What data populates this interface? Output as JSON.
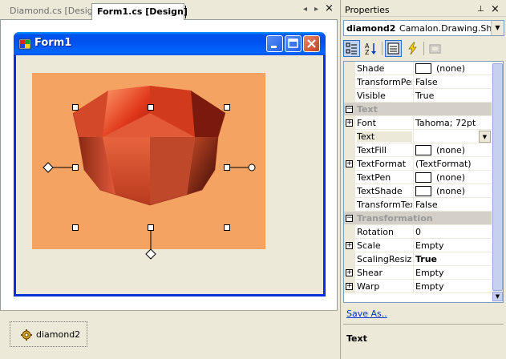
{
  "document_tabs": [
    {
      "label": "Diamond.cs [Design]",
      "active": false
    },
    {
      "label": "Form1.cs [Design]",
      "active": true
    }
  ],
  "tab_controls": {
    "prev": "◂",
    "next": "▸",
    "close": "×"
  },
  "form": {
    "title": "Form1",
    "title_buttons": [
      "minimize",
      "maximize",
      "close"
    ]
  },
  "colors": {
    "panel_background": "#f5a363",
    "diamond_base": "#c0331a",
    "titlebar": "#0054e3",
    "link": "#0033cc"
  },
  "tray": {
    "component_label": "diamond2",
    "icon": "gear-icon"
  },
  "properties": {
    "title": "Properties",
    "pin_glyph": "⊥",
    "close_glyph": "×",
    "object_name": "diamond2",
    "object_type": "Camalon.Drawing.Shape",
    "toolbar_buttons": [
      "categorized-icon",
      "alphabetical-icon",
      "properties-icon",
      "events-icon",
      "property-pages-icon"
    ],
    "rows": [
      {
        "name": "Shade",
        "value": "(none)",
        "kind": "swatch"
      },
      {
        "name": "TransformPen",
        "value": "False"
      },
      {
        "name": "Visible",
        "value": "True"
      },
      {
        "name": "Text",
        "kind": "category"
      },
      {
        "name": "Font",
        "value": "Tahoma; 72pt",
        "expand": "+"
      },
      {
        "name": "Text",
        "value": "",
        "kind": "selected"
      },
      {
        "name": "TextFill",
        "value": "(none)",
        "kind": "swatch"
      },
      {
        "name": "TextFormat",
        "value": "(TextFormat)",
        "expand": "+"
      },
      {
        "name": "TextPen",
        "value": "(none)",
        "kind": "swatch"
      },
      {
        "name": "TextShade",
        "value": "(none)",
        "kind": "swatch"
      },
      {
        "name": "TransformTex",
        "value": "False"
      },
      {
        "name": "Transformation",
        "kind": "category"
      },
      {
        "name": "Rotation",
        "value": "0"
      },
      {
        "name": "Scale",
        "value": "Empty",
        "expand": "+"
      },
      {
        "name": "ScalingResize",
        "value": "True",
        "kind": "bold"
      },
      {
        "name": "Shear",
        "value": "Empty",
        "expand": "+"
      },
      {
        "name": "Warp",
        "value": "Empty",
        "expand": "+"
      }
    ],
    "command_link": "Save As..",
    "description_title": "Text",
    "category_collapse_glyph": "−",
    "dropdown_glyph": "▼"
  }
}
